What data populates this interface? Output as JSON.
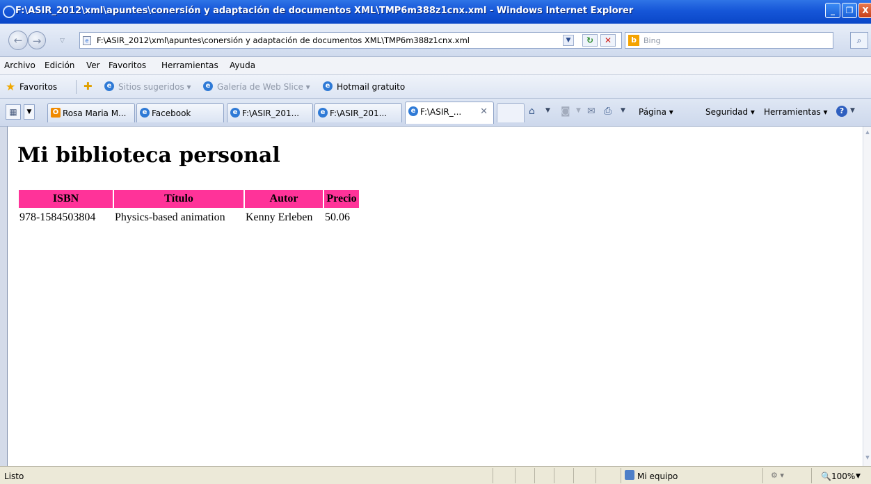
{
  "window": {
    "title": "F:\\ASIR_2012\\xml\\apuntes\\conersión y adaptación de documentos XML\\TMP6m388z1cnx.xml - Windows Internet Explorer",
    "min_glyph": "_",
    "max_glyph": "❐",
    "close_glyph": "X"
  },
  "address_bar": {
    "url": "F:\\ASIR_2012\\xml\\apuntes\\conersión y adaptación de documentos XML\\TMP6m388z1cnx.xml",
    "back_glyph": "←",
    "forward_glyph": "→"
  },
  "search": {
    "placeholder": "Bing",
    "logo": "b"
  },
  "menu": {
    "items": [
      "Archivo",
      "Edición",
      "Ver",
      "Favoritos",
      "Herramientas",
      "Ayuda"
    ]
  },
  "favorites_bar": {
    "label": "Favoritos",
    "items": [
      {
        "label": "Sitios sugeridos ▾",
        "enabled": false
      },
      {
        "label": "Galería de Web Slice ▾",
        "enabled": false
      },
      {
        "label": "Hotmail gratuito",
        "enabled": true
      }
    ]
  },
  "tabs": [
    {
      "label": "Rosa Maria M...",
      "icon": "outlook-icon",
      "active": false
    },
    {
      "label": "Facebook",
      "icon": "ie-icon",
      "active": false
    },
    {
      "label": "F:\\ASIR_201...",
      "icon": "ie-icon",
      "active": false
    },
    {
      "label": "F:\\ASIR_201...",
      "icon": "ie-icon",
      "active": false
    },
    {
      "label": "F:\\ASIR_...",
      "icon": "ie-icon",
      "active": true
    }
  ],
  "command_bar": {
    "page": "Página ▾",
    "safety": "Seguridad ▾",
    "tools": "Herramientas ▾"
  },
  "document": {
    "title": "Mi biblioteca personal",
    "columns": [
      "ISBN",
      "Título",
      "Autor",
      "Precio"
    ],
    "rows": [
      [
        "978-1584503804",
        "Physics-based animation",
        "Kenny Erleben",
        "50.06"
      ]
    ],
    "header_color": "#ff3399"
  },
  "status_bar": {
    "status": "Listo",
    "zone": "Mi equipo",
    "zoom": "100%"
  }
}
